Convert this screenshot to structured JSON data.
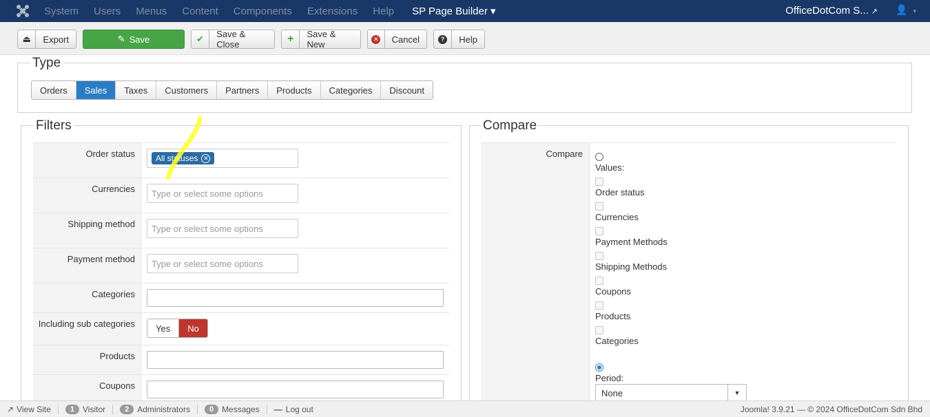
{
  "navbar": {
    "menu": [
      "System",
      "Users",
      "Menus",
      "Content",
      "Components",
      "Extensions",
      "Help"
    ],
    "sp_page_builder": "SP Page Builder ▾",
    "site_name": "OfficeDotCom S...",
    "user_caret": "▾"
  },
  "toolbar": {
    "export": "Export",
    "save": "Save",
    "save_close": "Save & Close",
    "save_new": "Save & New",
    "cancel": "Cancel",
    "help": "Help"
  },
  "type": {
    "legend": "Type",
    "tabs": [
      "Orders",
      "Sales",
      "Taxes",
      "Customers",
      "Partners",
      "Products",
      "Categories",
      "Discount"
    ],
    "active": "Sales"
  },
  "filters": {
    "legend": "Filters",
    "order_status_label": "Order status",
    "order_status_chip": "All statuses",
    "currencies_label": "Currencies",
    "currencies_placeholder": "Type or select some options",
    "shipping_label": "Shipping method",
    "shipping_placeholder": "Type or select some options",
    "payment_label": "Payment method",
    "payment_placeholder": "Type or select some options",
    "categories_label": "Categories",
    "sub_categories_label": "Including sub categories",
    "yes": "Yes",
    "no": "No",
    "products_label": "Products",
    "coupons_label": "Coupons"
  },
  "compare": {
    "legend": "Compare",
    "label": "Compare",
    "values_label": "Values:",
    "options": [
      "Order status",
      "Currencies",
      "Payment Methods",
      "Shipping Methods",
      "Coupons",
      "Products",
      "Categories"
    ],
    "period_label": "Period:",
    "period_value": "None"
  },
  "statusbar": {
    "view_site": "View Site",
    "visitor_count": "1",
    "visitor_label": "Visitor",
    "admin_count": "2",
    "admin_label": "Administrators",
    "messages_count": "0",
    "messages_label": "Messages",
    "logout": "Log out",
    "version": "Joomla! 3.9.21",
    "copyright": "© 2024 OfficeDotCom Sdn Bhd"
  },
  "colors": {
    "navbar": "#1a3867",
    "save_green": "#46a546",
    "active_tab": "#2a7dc4",
    "no_red": "#bd362f",
    "chip": "#2b6ca3",
    "highlight": "#ffff33"
  }
}
